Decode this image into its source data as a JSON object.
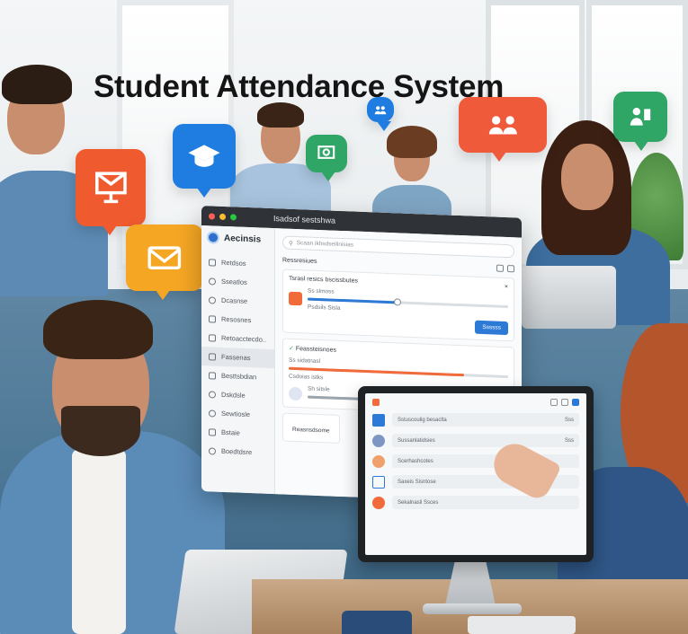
{
  "title": "Student Attendance System",
  "app_window": {
    "window_title": "Isadsof sestshwa",
    "brand_name": "Aecinsis",
    "search_placeholder": "Scaan ikhsdseilinisias",
    "sidebar": [
      {
        "label": "Retdsos",
        "icon": "grid-icon"
      },
      {
        "label": "Sseatlos",
        "icon": "user-icon"
      },
      {
        "label": "Dcasnse",
        "icon": "settings-icon"
      },
      {
        "label": "Resosnes",
        "icon": "list-icon"
      },
      {
        "label": "Retoacctecdo..",
        "icon": "folder-icon"
      },
      {
        "label": "Fassenas",
        "icon": "calendar-icon",
        "active": true
      },
      {
        "label": "Besttsbdian",
        "icon": "chart-icon"
      },
      {
        "label": "Dskdsle",
        "icon": "bell-icon"
      },
      {
        "label": "Sewtiosle",
        "icon": "gear-icon"
      },
      {
        "label": "Bstaie",
        "icon": "book-icon"
      },
      {
        "label": "Boedtdsre",
        "icon": "help-icon"
      }
    ],
    "section_header": "Ressresiues",
    "panel_title": "Tsrasl resics bscissbutes",
    "row1": {
      "name": "Ss slmoss",
      "sub": "Psdsils Sisla"
    },
    "progress1": 0.45,
    "save_button": "Ssssss",
    "section2_title": "Feassteisnoes",
    "row2": {
      "name": "Ss sidatnasl",
      "sub": "Csdoias istks"
    },
    "progress2": 0.8,
    "row3": {
      "name": "Sh sitsle"
    },
    "progress3": 0.35,
    "bottom_button": "Reasnsdsome"
  },
  "monitor": {
    "list": [
      {
        "label": "Sstuscoulig besaclta",
        "tag": "Sss"
      },
      {
        "label": "Sussanlatidsies",
        "tag": "Sss"
      },
      {
        "label": "Scerhashcotes",
        "tag": ""
      },
      {
        "label": "Saxeis Sisntose",
        "tag": ""
      },
      {
        "label": "Sekalnasli Ssces",
        "tag": ""
      }
    ]
  },
  "colors": {
    "accent_blue": "#2d7ad6",
    "orange": "#f06a3a",
    "green": "#2fa566",
    "titlebar": "#2f3338"
  }
}
